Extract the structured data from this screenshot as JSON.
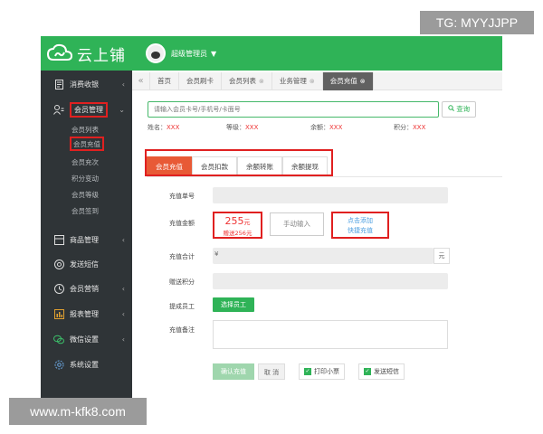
{
  "watermarks": {
    "top": "TG: MYYJJPP",
    "bottom": "www.m-kfk8.com"
  },
  "brand": {
    "logo_text": "云上铺",
    "accent": "#2fb357"
  },
  "header": {
    "user_name": "超级管理员",
    "caret": "▼"
  },
  "sidebar": {
    "items": [
      {
        "label": "消费收银",
        "icon": "receipt-icon",
        "chevron": "‹"
      },
      {
        "label": "会员管理",
        "icon": "member-icon",
        "chevron": "⌄"
      },
      {
        "label": "商品管理",
        "icon": "goods-icon",
        "chevron": "‹"
      },
      {
        "label": "发送短信",
        "icon": "sms-icon",
        "chevron": ""
      },
      {
        "label": "会员营销",
        "icon": "marketing-icon",
        "chevron": "‹"
      },
      {
        "label": "报表管理",
        "icon": "report-icon",
        "chevron": "‹"
      },
      {
        "label": "微信设置",
        "icon": "wechat-icon",
        "chevron": "‹"
      },
      {
        "label": "系统设置",
        "icon": "settings-icon",
        "chevron": ""
      }
    ],
    "subitems": [
      "会员列表",
      "会员充值",
      "会员充次",
      "积分变动",
      "会员等级",
      "会员签到"
    ]
  },
  "tabs": {
    "nav": "«",
    "items": [
      {
        "label": "首页",
        "close": ""
      },
      {
        "label": "会员刷卡",
        "close": ""
      },
      {
        "label": "会员列表",
        "close": "⊗"
      },
      {
        "label": "业务管理",
        "close": "⊗"
      },
      {
        "label": "会员充值",
        "close": "⊗"
      }
    ]
  },
  "search": {
    "placeholder": "请输入会员卡号/手机号/卡面号",
    "button": "查询",
    "button_icon": "search-icon"
  },
  "member_info": {
    "name_label": "姓名：",
    "name_value": "XXX",
    "level_label": "等级：",
    "level_value": "XXX",
    "balance_label": "余额：",
    "balance_value": "XXX",
    "points_label": "积分：",
    "points_value": "XXX"
  },
  "sub_tabs": [
    "会员充值",
    "会员扣款",
    "余额转账",
    "余额提现"
  ],
  "form": {
    "order_no_label": "充值单号",
    "amount_label": "充值金额",
    "amount_value": "255",
    "amount_unit": "元",
    "amount_bonus": "赠送256元",
    "manual_input": "手动输入",
    "quick_line1": "点击添加",
    "quick_line2": "快捷充值",
    "total_label": "充值合计",
    "total_prefix": "¥",
    "total_unit": "元",
    "bonus_points_label": "赠送积分",
    "staff_label": "提成员工",
    "staff_button": "选择员工",
    "remark_label": "充值备注"
  },
  "actions": {
    "confirm": "确认充值",
    "cancel": "取 消",
    "print_receipt": "打印小票",
    "send_sms": "发送短信"
  }
}
